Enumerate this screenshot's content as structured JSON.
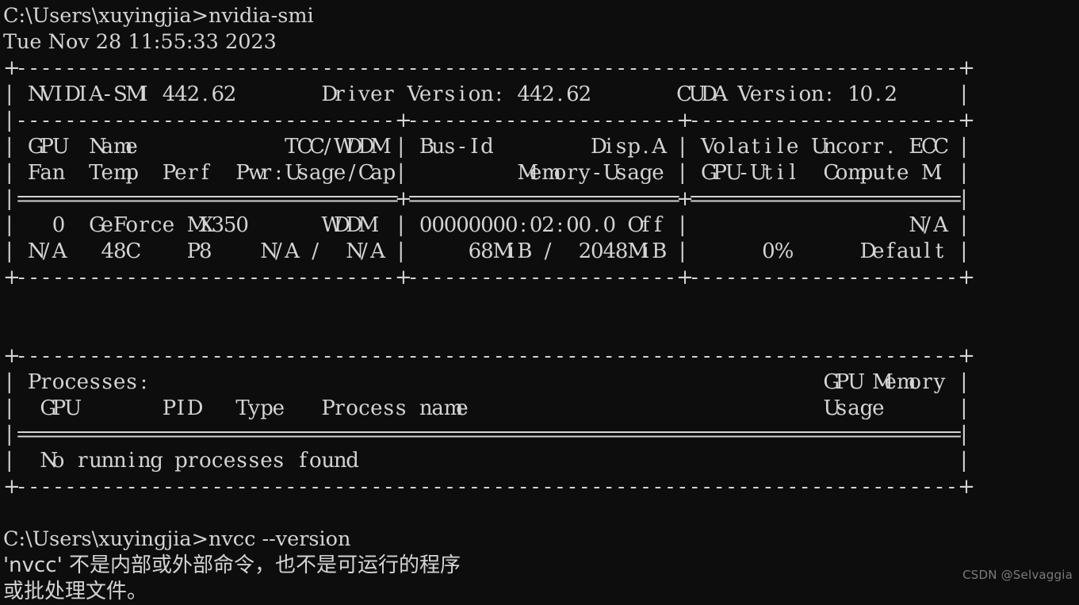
{
  "terminal": {
    "background_color": "#0d0d0d",
    "text_color": "#d4d4d4",
    "prompt_1": "C:\\Users\\xuyingjia>nvidia-smi",
    "timestamp": "Tue Nov 28 11:55:33 2023",
    "smi_table": [
      "+-----------------------------------------------------------------------------+",
      "| NVIDIA-SMI 442.62       Driver Version: 442.62       CUDA Version: 10.2     |",
      "|-------------------------------+----------------------+----------------------+",
      "| GPU  Name            TCC/WDDM | Bus-Id        Disp.A | Volatile Uncorr. ECC |",
      "| Fan  Temp  Perf  Pwr:Usage/Cap|         Memory-Usage | GPU-Util  Compute M. |",
      "|===============================+======================+======================|",
      "|   0  GeForce MX350      WDDM  | 00000000:02:00.0 Off |                  N/A |",
      "| N/A   48C    P8    N/A /  N/A |     68MiB /  2048MiB |      0%      Default |",
      "+-------------------------------+----------------------+----------------------+"
    ],
    "processes_table": [
      "+-----------------------------------------------------------------------------+",
      "| Processes:                                                       GPU Memory |",
      "|  GPU       PID   Type   Process name                             Usage      |",
      "|=============================================================================|",
      "|  No running processes found                                                 |",
      "+-----------------------------------------------------------------------------+"
    ],
    "prompt_2": "C:\\Users\\xuyingjia>nvcc --version",
    "error_line_1": "'nvcc' 不是内部或外部命令，也不是可运行的程序",
    "error_line_2": "或批处理文件。"
  },
  "smi_values": {
    "nvidia_smi_version": "442.62",
    "driver_version": "442.62",
    "cuda_version": "10.2",
    "gpu_index": "0",
    "gpu_name": "GeForce MX350",
    "tcc_wddm": "WDDM",
    "bus_id": "00000000:02:00.0",
    "disp_a": "Off",
    "ecc": "N/A",
    "fan": "N/A",
    "temp": "48C",
    "perf": "P8",
    "pwr_usage_cap": "N/A /  N/A",
    "memory_used": "68MiB",
    "memory_total": "2048MiB",
    "gpu_util": "0%",
    "compute_mode": "Default",
    "processes_status": "No running processes found"
  },
  "watermark": {
    "text": "CSDN @Selvaggia"
  }
}
